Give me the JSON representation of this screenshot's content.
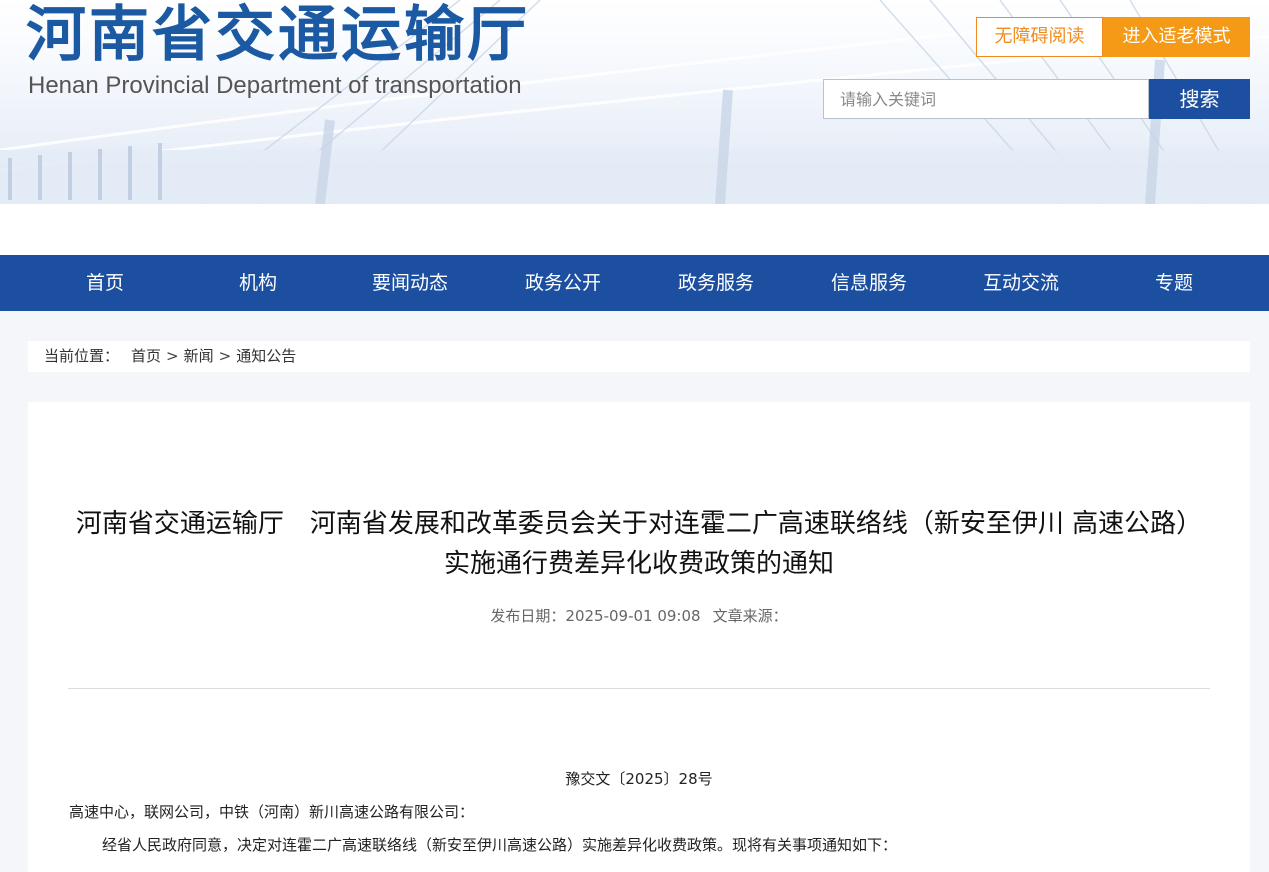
{
  "header": {
    "site_title": "河南省交通运输厅",
    "site_subtitle": "Henan Provincial Department of transportation",
    "accessibility_label": "无障碍阅读",
    "elder_mode_label": "进入适老模式",
    "search": {
      "placeholder": "请输入关键词",
      "value": "",
      "button_label": "搜索"
    }
  },
  "nav": {
    "items": [
      "首页",
      "机构",
      "要闻动态",
      "政务公开",
      "政务服务",
      "信息服务",
      "互动交流",
      "专题"
    ]
  },
  "breadcrumb": {
    "label": "当前位置：",
    "separator": ">",
    "items": [
      "首页",
      "新闻",
      "通知公告"
    ]
  },
  "article": {
    "title": "河南省交通运输厅　河南省发展和改革委员会关于对连霍二广高速联络线（新安至伊川 高速公路）实施通行费差异化收费政策的通知",
    "publish_label": "发布日期：",
    "publish_date": "2025-09-01 09:08",
    "source_label": "文章来源：",
    "source_value": "",
    "doc_number": "豫交文〔2025〕28号",
    "addressee": "高速中心，联网公司，中铁（河南）新川高速公路有限公司：",
    "paragraph_1": "经省人民政府同意，决定对连霍二广高速联络线（新安至伊川高速公路）实施差异化收费政策。现将有关事项通知如下："
  },
  "colors": {
    "brand_blue": "#1c4fa0",
    "title_blue": "#1b5aa3",
    "accent_orange": "#f59a16",
    "page_bg": "#f4f6fa"
  }
}
